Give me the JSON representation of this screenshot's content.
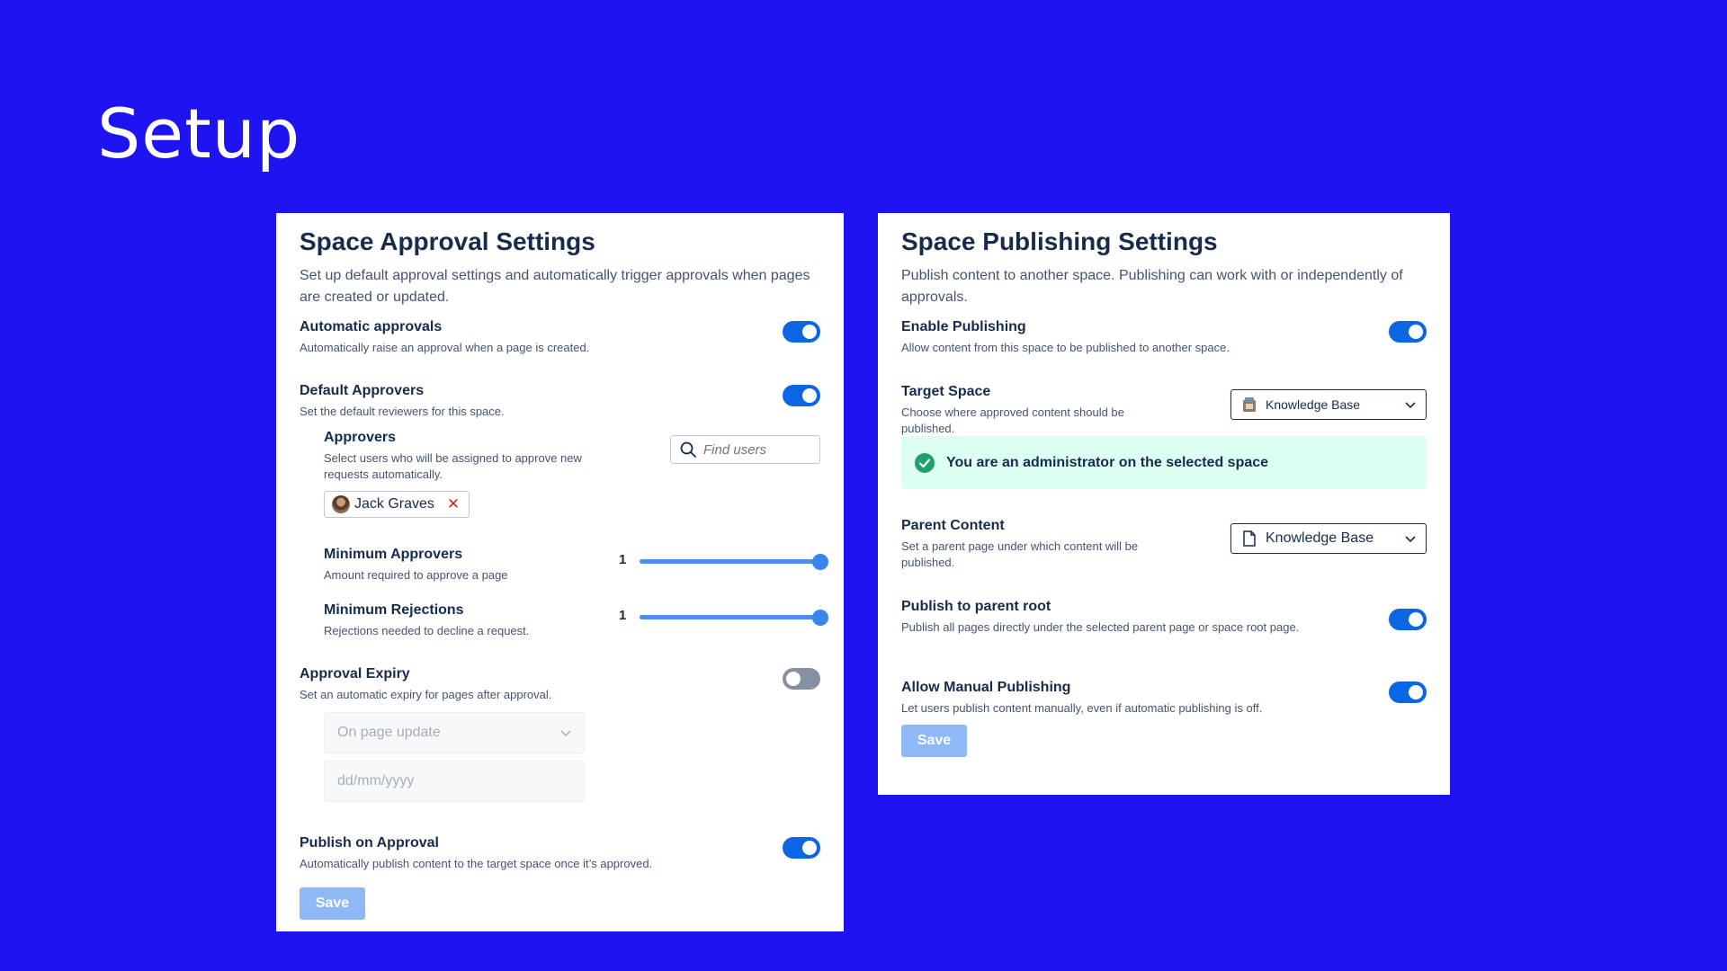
{
  "page": {
    "title": "Setup"
  },
  "approval": {
    "title": "Space Approval Settings",
    "description": "Set up default approval settings and automatically trigger approvals when pages are created or updated.",
    "automatic": {
      "label": "Automatic approvals",
      "sub": "Automatically raise an approval when a page is created.",
      "on": true
    },
    "default_approvers": {
      "label": "Default Approvers",
      "sub": "Set the default reviewers for this space.",
      "on": true
    },
    "approvers": {
      "label": "Approvers",
      "sub": "Select users who will be assigned to approve new requests automatically.",
      "search_placeholder": "Find users",
      "selected": [
        {
          "name": "Jack Graves"
        }
      ]
    },
    "min_approvers": {
      "label": "Minimum Approvers",
      "sub": "Amount required to approve a page",
      "value": "1",
      "fraction": 1.0
    },
    "min_rejections": {
      "label": "Minimum Rejections",
      "sub": "Rejections needed to decline a request.",
      "value": "1",
      "fraction": 1.0
    },
    "expiry": {
      "label": "Approval Expiry",
      "sub": "Set an automatic expiry for pages after approval.",
      "on": false,
      "trigger": "On page update",
      "date_placeholder": "dd/mm/yyyy"
    },
    "publish_on_approval": {
      "label": "Publish on Approval",
      "sub": "Automatically publish content to the target space once it’s approved.",
      "on": true
    },
    "save_label": "Save"
  },
  "publishing": {
    "title": "Space Publishing Settings",
    "description": "Publish content to another space. Publishing can work with or independently of approvals.",
    "enable": {
      "label": "Enable Publishing",
      "sub": "Allow content from this space to be published to another space.",
      "on": true
    },
    "target_space": {
      "label": "Target Space",
      "sub": "Choose where approved content should be published.",
      "value": "Knowledge Base"
    },
    "admin_notice": "You are an administrator on the selected space",
    "parent_content": {
      "label": "Parent Content",
      "sub": "Set a parent page under which content will be published.",
      "value": "Knowledge Base"
    },
    "publish_root": {
      "label": "Publish to parent root",
      "sub": "Publish all pages directly under the selected parent page or space root page.",
      "on": true
    },
    "manual": {
      "label": "Allow Manual Publishing",
      "sub": "Let users publish content manually, even if automatic publishing is off.",
      "on": true
    },
    "save_label": "Save"
  },
  "colors": {
    "background": "#1e14f2",
    "toggle_on": "#0c66e4",
    "toggle_off": "#8590a2",
    "success_bg": "#dcfff1",
    "success_icon": "#22a06b"
  }
}
